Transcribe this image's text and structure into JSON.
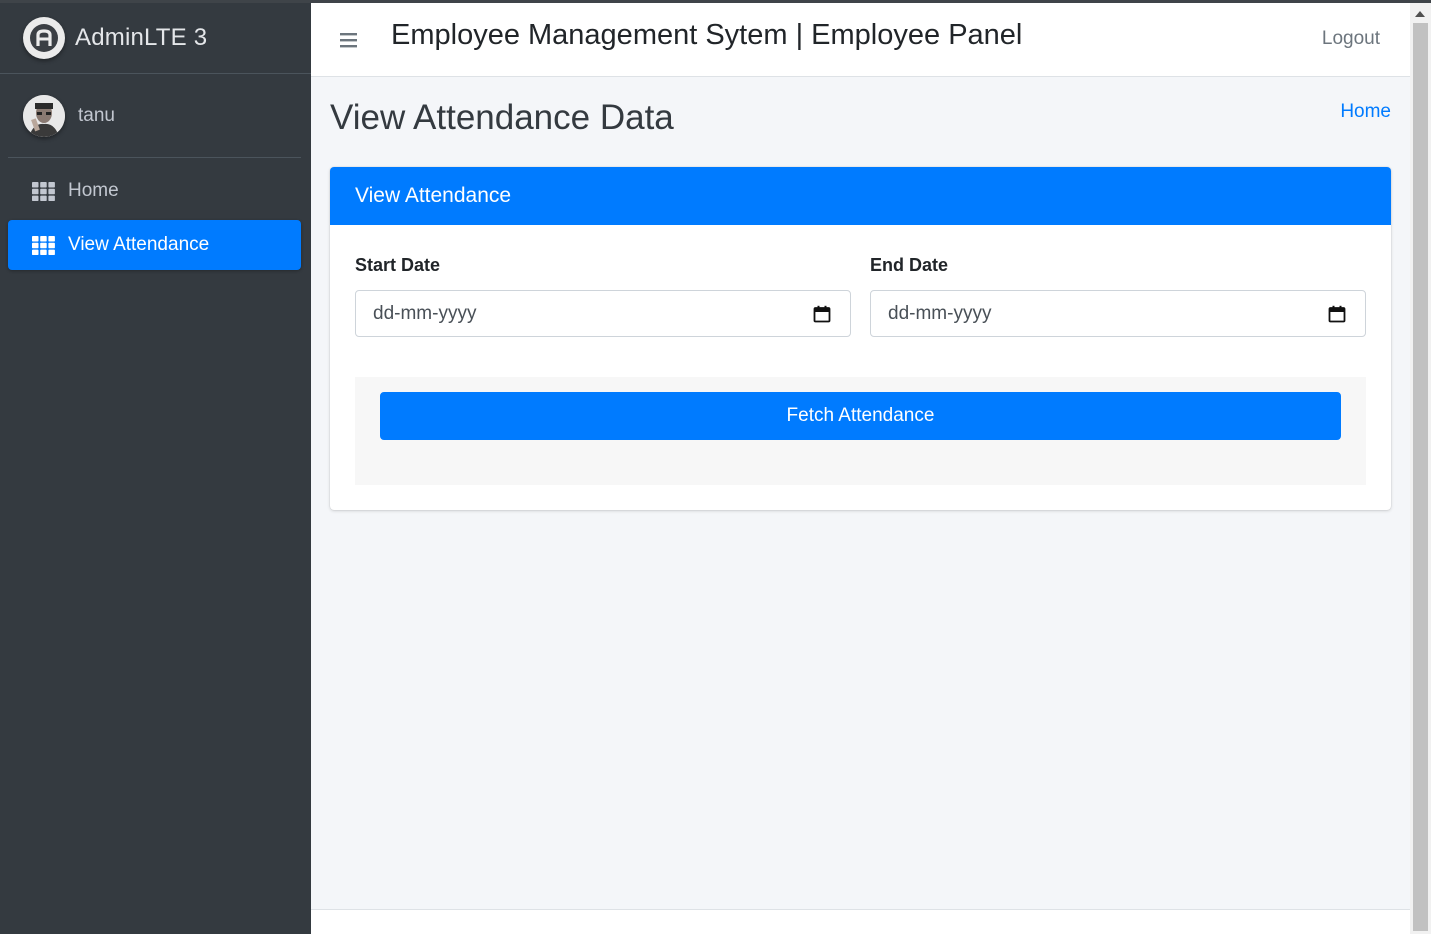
{
  "sidebar": {
    "brand_text": "AdminLTE 3",
    "user_name": "tanu",
    "items": [
      {
        "label": "Home",
        "icon": "grid-icon",
        "active": false
      },
      {
        "label": "View Attendance",
        "icon": "grid-icon",
        "active": true
      }
    ]
  },
  "navbar": {
    "title": "Employee Management Sytem | Employee Panel",
    "logout_label": "Logout"
  },
  "content_header": {
    "title": "View Attendance Data",
    "breadcrumb": "Home"
  },
  "card": {
    "title": "View Attendance",
    "start_date": {
      "label": "Start Date",
      "placeholder": "dd-mm-yyyy"
    },
    "end_date": {
      "label": "End Date",
      "placeholder": "dd-mm-yyyy"
    },
    "submit_label": "Fetch Attendance"
  },
  "colors": {
    "primary": "#007bff",
    "sidebar_bg": "#343a40",
    "content_bg": "#f4f6f9"
  }
}
